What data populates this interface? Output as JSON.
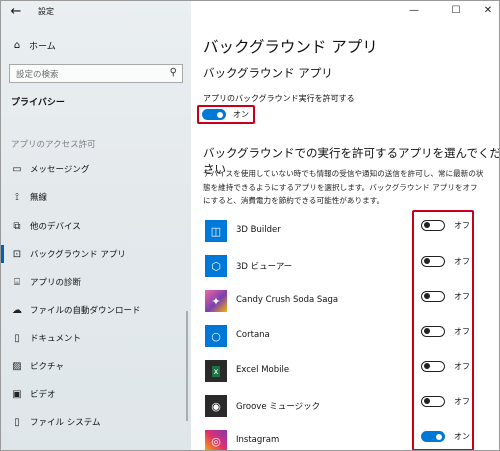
{
  "window": {
    "title": "設定"
  },
  "sidebar": {
    "home_label": "ホーム",
    "search_placeholder": "設定の検索",
    "category": "プライバシー",
    "section_header": "アプリのアクセス許可",
    "items": [
      {
        "label": "メッセージング",
        "icon": "message-icon"
      },
      {
        "label": "無線",
        "icon": "radio-icon"
      },
      {
        "label": "他のデバイス",
        "icon": "devices-icon"
      },
      {
        "label": "バックグラウンド アプリ",
        "icon": "background-apps-icon",
        "active": true
      },
      {
        "label": "アプリの診断",
        "icon": "diagnostics-icon"
      },
      {
        "label": "ファイルの自動ダウンロード",
        "icon": "cloud-icon"
      },
      {
        "label": "ドキュメント",
        "icon": "document-icon"
      },
      {
        "label": "ピクチャ",
        "icon": "picture-icon"
      },
      {
        "label": "ビデオ",
        "icon": "video-icon"
      },
      {
        "label": "ファイル システム",
        "icon": "file-system-icon"
      }
    ]
  },
  "main": {
    "title": "バックグラウンド アプリ",
    "subtitle": "バックグラウンド アプリ",
    "allow_label": "アプリのバックグラウンド実行を許可する",
    "allow_state": "オン",
    "choose_heading": "バックグラウンドでの実行を許可するアプリを選んでください",
    "description": "デバイスを使用していない時でも情報の受信や通知の送信を許可し、常に最新の状態を維持できるようにするアプリを選択します。バックグラウンド アプリをオフにすると、消費電力を節約できる可能性があります。",
    "apps": [
      {
        "name": "3D Builder",
        "state": "オフ",
        "on": false,
        "icon": "3d-builder-icon",
        "color": "#0078d7"
      },
      {
        "name": "3D ビューアー",
        "state": "オフ",
        "on": false,
        "icon": "3d-viewer-icon",
        "color": "#0078d7"
      },
      {
        "name": "Candy Crush Soda Saga",
        "state": "オフ",
        "on": false,
        "icon": "candy-crush-icon",
        "color": "#7a3fb0"
      },
      {
        "name": "Cortana",
        "state": "オフ",
        "on": false,
        "icon": "cortana-icon",
        "color": "#0078d7"
      },
      {
        "name": "Excel Mobile",
        "state": "オフ",
        "on": false,
        "icon": "excel-icon",
        "color": "#2a2a2a"
      },
      {
        "name": "Groove ミュージック",
        "state": "オフ",
        "on": false,
        "icon": "groove-music-icon",
        "color": "#2a2a2a"
      },
      {
        "name": "Instagram",
        "state": "オン",
        "on": true,
        "icon": "instagram-icon",
        "color": "#c13584"
      }
    ]
  },
  "colors": {
    "accent": "#0078d7",
    "highlight": "#c8001e"
  }
}
